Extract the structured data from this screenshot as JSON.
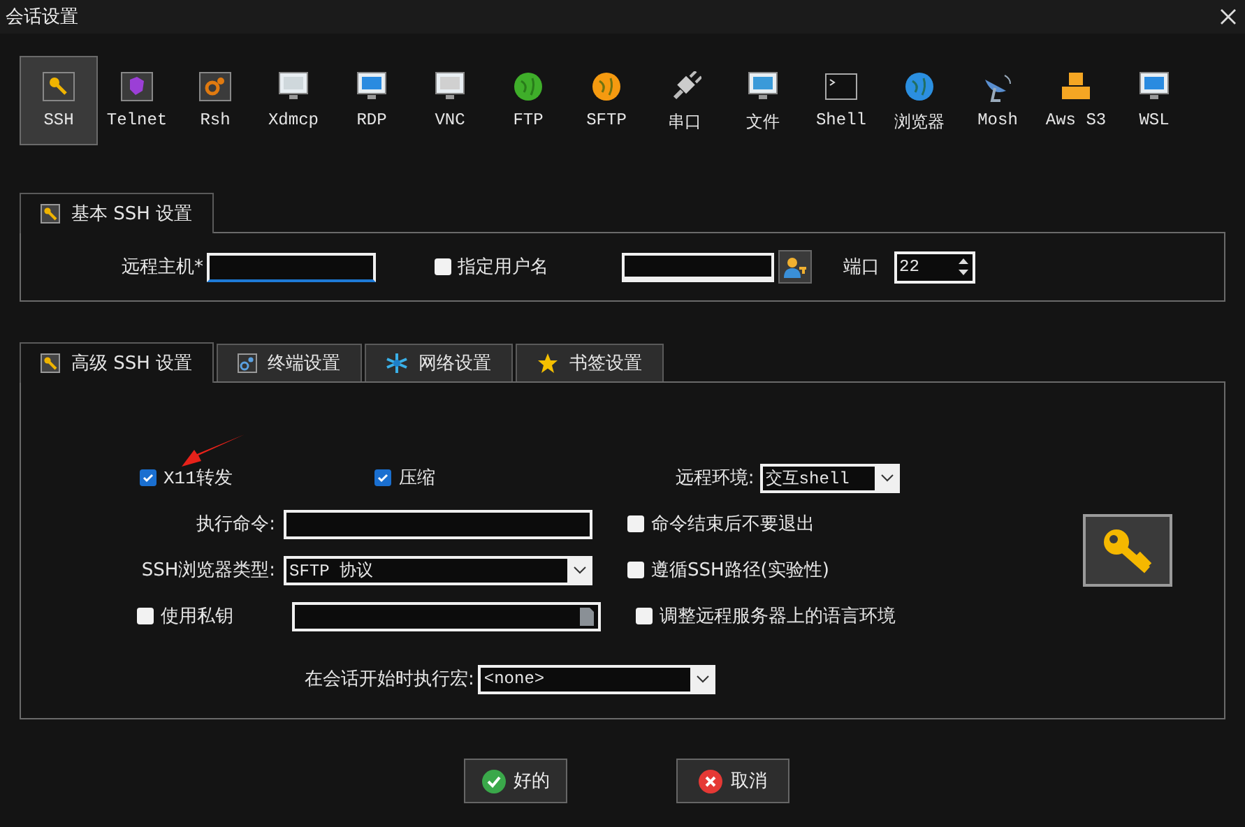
{
  "window": {
    "title": "会话设置"
  },
  "protocols": [
    {
      "label": "SSH",
      "selected": true
    },
    {
      "label": "Telnet",
      "selected": false
    },
    {
      "label": "Rsh",
      "selected": false
    },
    {
      "label": "Xdmcp",
      "selected": false
    },
    {
      "label": "RDP",
      "selected": false
    },
    {
      "label": "VNC",
      "selected": false
    },
    {
      "label": "FTP",
      "selected": false
    },
    {
      "label": "SFTP",
      "selected": false
    },
    {
      "label": "串口",
      "selected": false
    },
    {
      "label": "文件",
      "selected": false
    },
    {
      "label": "Shell",
      "selected": false
    },
    {
      "label": "浏览器",
      "selected": false
    },
    {
      "label": "Mosh",
      "selected": false
    },
    {
      "label": "Aws S3",
      "selected": false
    },
    {
      "label": "WSL",
      "selected": false
    }
  ],
  "basic": {
    "tab": {
      "label": "基本 SSH 设置",
      "selected": true
    },
    "remote_host": {
      "label": "远程主机*"
    },
    "specify_username": {
      "label": "指定用户名",
      "checked": false
    },
    "port": {
      "label": "端口",
      "value": "22"
    }
  },
  "advanced_tabs": [
    {
      "label": "高级 SSH 设置",
      "selected": true
    },
    {
      "label": "终端设置",
      "selected": false
    },
    {
      "label": "网络设置",
      "selected": false
    },
    {
      "label": "书签设置",
      "selected": false
    }
  ],
  "advanced": {
    "x11": {
      "label": "X11转发",
      "checked": true
    },
    "compression": {
      "label": "压缩",
      "checked": true
    },
    "remote_env": {
      "label": "远程环境:",
      "value": "交互shell"
    },
    "exec_command": {
      "label": "执行命令:"
    },
    "no_exit": {
      "label": "命令结束后不要退出",
      "checked": false
    },
    "browser_type": {
      "label": "SSH浏览器类型:",
      "value": "SFTP 协议"
    },
    "follow_path": {
      "label": "遵循SSH路径(实验性)",
      "checked": false
    },
    "private_key": {
      "label": "使用私钥",
      "checked": false
    },
    "adjust_locale": {
      "label": "调整远程服务器上的语言环境",
      "checked": false
    },
    "macro": {
      "label": "在会话开始时执行宏:",
      "value": "<none>"
    }
  },
  "buttons": [
    {
      "label": "好的",
      "kind": "ok"
    },
    {
      "label": "取消",
      "kind": "cancel"
    }
  ]
}
